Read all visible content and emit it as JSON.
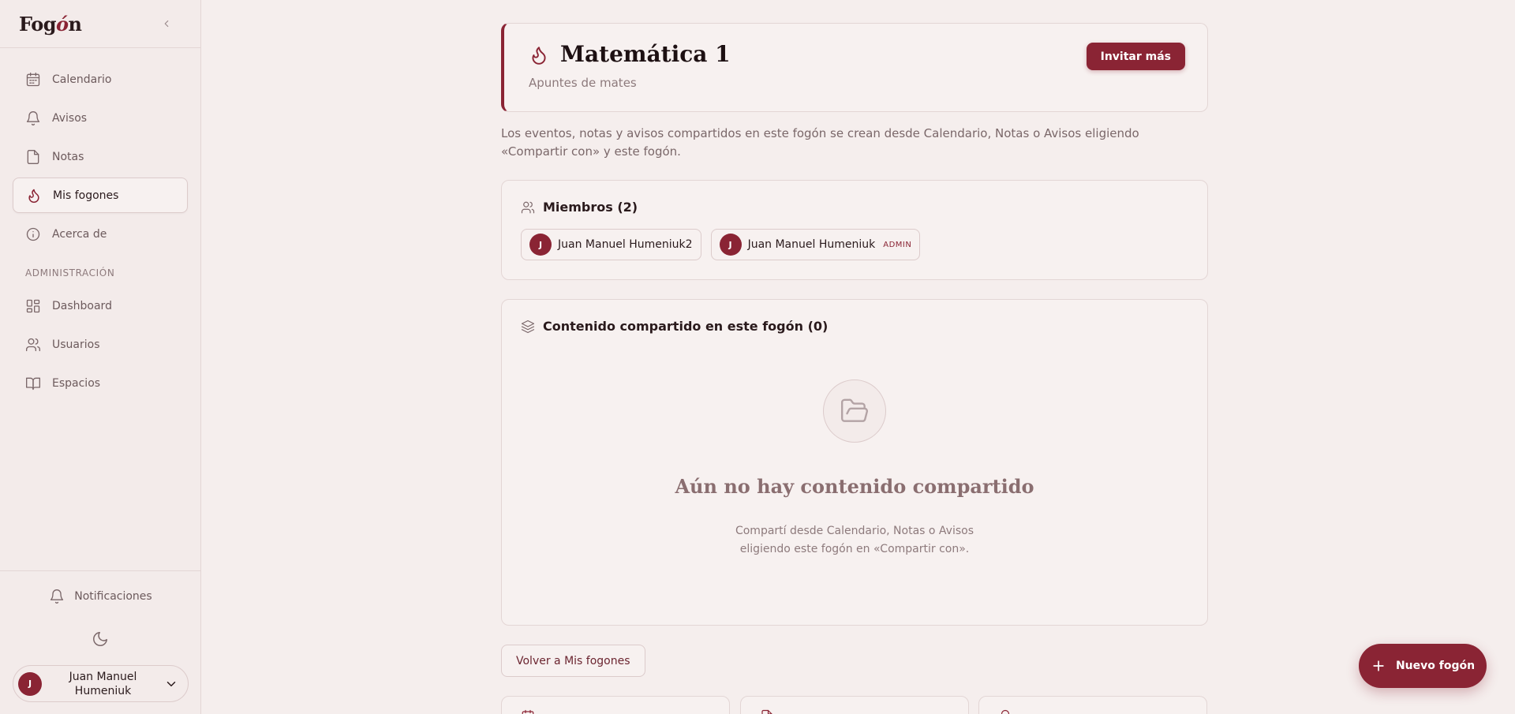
{
  "brand": {
    "logo_prefix": "Fog",
    "logo_accent": "ó",
    "logo_suffix": "n",
    "accent_color": "#8a2434"
  },
  "sidebar": {
    "items": [
      {
        "label": "Calendario",
        "icon": "calendar-icon"
      },
      {
        "label": "Avisos",
        "icon": "bell-icon"
      },
      {
        "label": "Notas",
        "icon": "file-icon"
      },
      {
        "label": "Mis fogones",
        "icon": "flame-icon",
        "active": true
      },
      {
        "label": "Acerca de",
        "icon": "info-icon"
      }
    ],
    "admin_section_label": "ADMINISTRACIÓN",
    "admin_items": [
      {
        "label": "Dashboard",
        "icon": "dashboard-icon"
      },
      {
        "label": "Usuarios",
        "icon": "users-icon"
      },
      {
        "label": "Espacios",
        "icon": "book-icon"
      }
    ],
    "notifications_label": "Notificaciones",
    "user": {
      "initial": "J",
      "name": "Juan Manuel Humeniuk"
    }
  },
  "header": {
    "title": "Matemática 1",
    "subtitle": "Apuntes de mates",
    "invite_button": "Invitar más"
  },
  "info_text": "Los eventos, notas y avisos compartidos en este fogón se crean desde Calendario, Notas o Avisos eligiendo «Compartir con» y este fogón.",
  "members": {
    "title": "Miembros (2)",
    "list": [
      {
        "initial": "J",
        "name": "Juan Manuel Humeniuk2",
        "badge": ""
      },
      {
        "initial": "J",
        "name": "Juan Manuel Humeniuk",
        "badge": "ADMIN"
      }
    ]
  },
  "shared_content": {
    "title": "Contenido compartido en este fogón (0)",
    "empty_title": "Aún no hay contenido compartido",
    "empty_line1": "Compartí desde Calendario, Notas o Avisos",
    "empty_line2": "eligiendo este fogón en «Compartir con»."
  },
  "back_button": "Volver a Mis fogones",
  "fab_label": "Nuevo fogón"
}
